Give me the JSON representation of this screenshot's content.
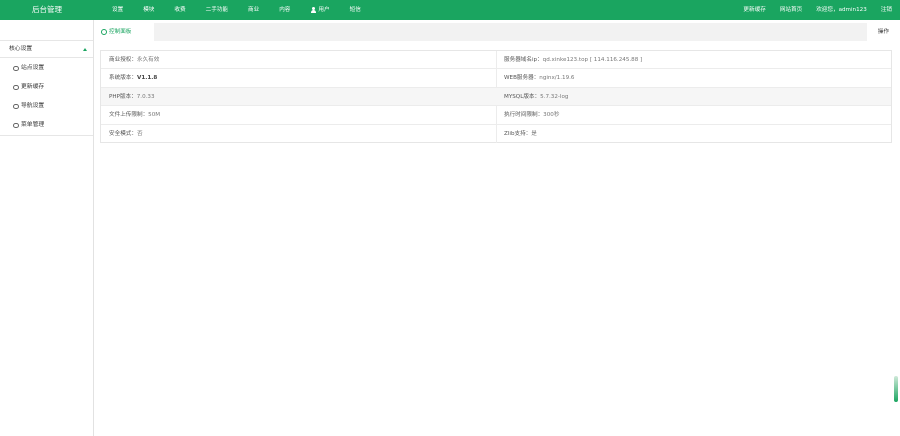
{
  "header": {
    "brand": "后台管理",
    "nav": [
      "设置",
      "模块",
      "收费",
      "二手功能",
      "商业",
      "内容",
      "用户",
      "短信"
    ],
    "right": [
      "更新缓存",
      "网站首页",
      "欢迎您，admin123",
      "注销"
    ]
  },
  "sidebar": {
    "group_label": "核心设置",
    "items": [
      "站点设置",
      "更新缓存",
      "导航设置",
      "菜单管理"
    ]
  },
  "tabs": {
    "active_label": "控制面板",
    "ops_label": "操作"
  },
  "info": {
    "rows": [
      {
        "left_label": "商业授权：",
        "left_value": "永久有效",
        "right_label": "服务器域名ip：",
        "right_value": "qd.xinke123.top [ 114.116.245.88 ]"
      },
      {
        "left_label": "系统版本：",
        "left_value": "V1.1.8",
        "right_label": "WEB服务器：",
        "right_value": "nginx/1.19.6"
      },
      {
        "left_label": "PHP版本：",
        "left_value": "7.0.33",
        "right_label": "MYSQL版本：",
        "right_value": "5.7.32-log"
      },
      {
        "left_label": "文件上传限制：",
        "left_value": "50M",
        "right_label": "执行时间限制：",
        "right_value": "300秒"
      },
      {
        "left_label": "安全模式：",
        "left_value": "否",
        "right_label": "Zlib支持：",
        "right_value": "是"
      }
    ]
  },
  "colors": {
    "accent": "#1aa560",
    "tabbar": "#f2f2f2",
    "row_alt": "#f6f6f6"
  },
  "icons": {
    "user": "user-icon",
    "collapse": "caret-up-icon",
    "tab": "circle-icon",
    "menu_item": "circle-icon"
  }
}
